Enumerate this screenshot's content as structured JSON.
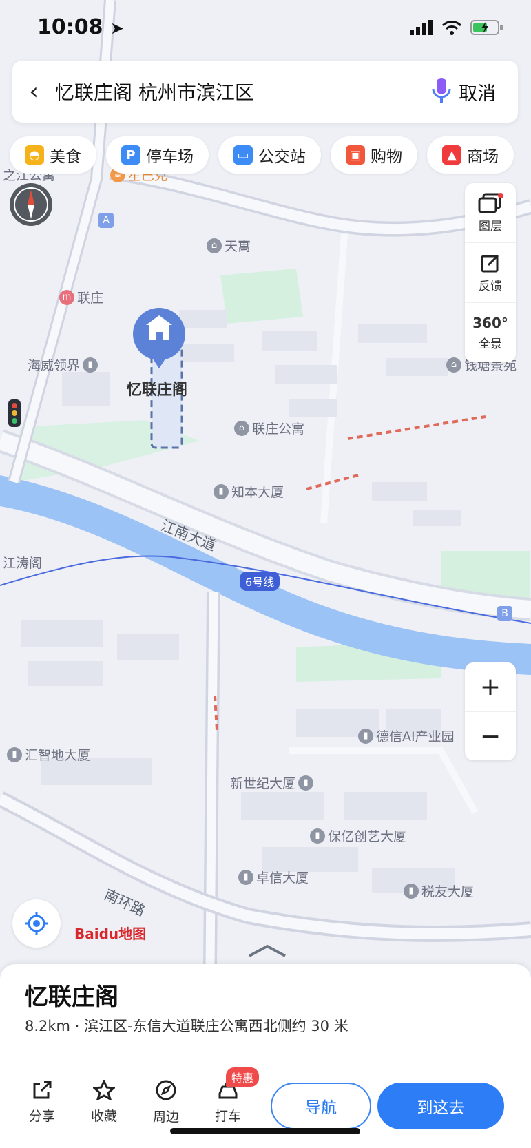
{
  "status_bar": {
    "time": "10:08"
  },
  "search": {
    "query": "忆联庄阁 杭州市滨江区",
    "cancel_label": "取消"
  },
  "categories": [
    {
      "label": "美食",
      "icon": "food-icon",
      "color": "#f6b21a"
    },
    {
      "label": "停车场",
      "icon": "parking-icon",
      "color": "#3d8bf5"
    },
    {
      "label": "公交站",
      "icon": "bus-stop-icon",
      "color": "#3d8bf5"
    },
    {
      "label": "购物",
      "icon": "shopping-icon",
      "color": "#f0573b"
    },
    {
      "label": "商场",
      "icon": "mall-icon",
      "color": "#ef3b3b"
    }
  ],
  "map_tools": {
    "layers_label": "图层",
    "feedback_label": "反馈",
    "panorama_label": "全景",
    "panorama_badge": "360°"
  },
  "map": {
    "selected_place": "忆联庄阁",
    "pois": {
      "tianyu": "天寓",
      "lianzhuang": "联庄",
      "haiwei": "海威领界",
      "lianzhuang_apt": "联庄公寓",
      "zhiben": "知本大厦",
      "jiangtao": "江涛阁",
      "dexin": "德信AI产业园",
      "huizhi": "汇智地大厦",
      "xinshiji": "新世纪大厦",
      "baoyi": "保亿创艺大厦",
      "zhuoxin": "卓信大厦",
      "shuiyou": "税友大厦",
      "qianfang": "钱塘景苑",
      "zhijiang": "之江公寓",
      "xingbake": "星巴克"
    },
    "roads": {
      "jiangnan": "江南大道",
      "nanhuan": "南环路"
    },
    "metro_line": "6号线",
    "markers": {
      "a": "A",
      "b": "B"
    }
  },
  "logo": {
    "text": "Baidu地图"
  },
  "sheet": {
    "name": "忆联庄阁",
    "info": "8.2km · 滨江区-东信大道联庄公寓西北侧约 30 米",
    "actions": [
      {
        "label": "分享",
        "icon": "share-icon"
      },
      {
        "label": "收藏",
        "icon": "star-icon"
      },
      {
        "label": "周边",
        "icon": "compass-icon"
      },
      {
        "label": "打车",
        "icon": "taxi-icon",
        "badge": "特惠"
      }
    ],
    "nav_label": "导航",
    "go_label": "到这去"
  },
  "colors": {
    "accent": "#2d7df6",
    "river": "#8fb9f3",
    "park": "#d6f0e0",
    "pin": "#5b82d6"
  }
}
